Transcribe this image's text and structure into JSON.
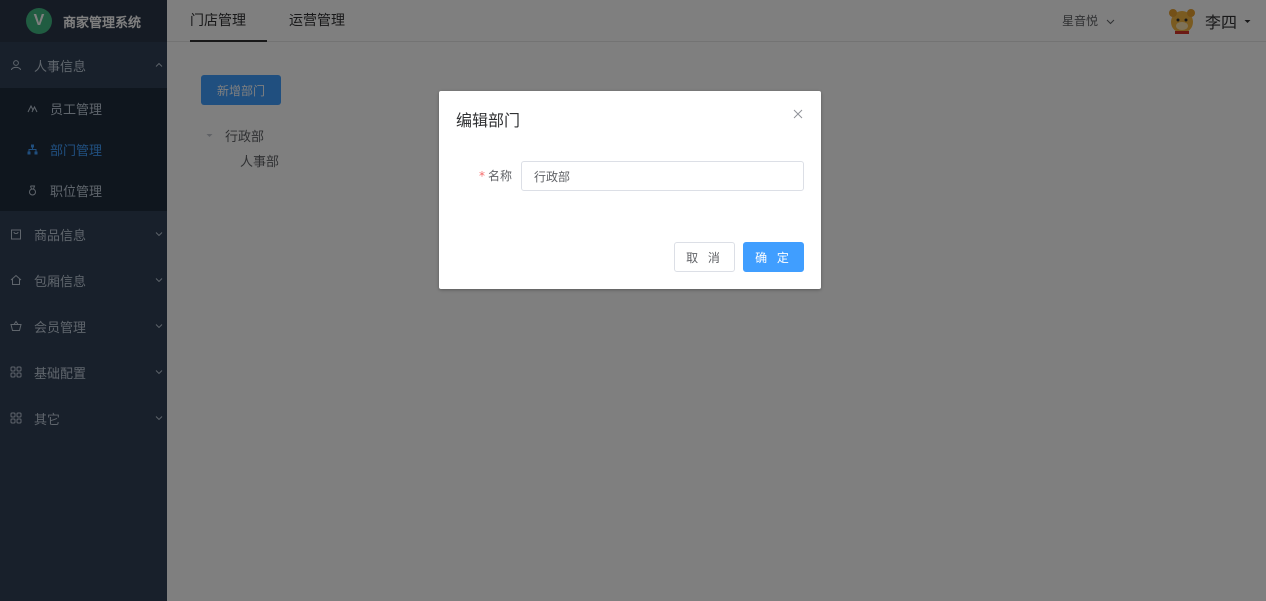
{
  "app": {
    "logo_letter": "V",
    "title": "商家管理系统"
  },
  "sidebar": {
    "groups": [
      {
        "label": "人事信息",
        "icon": "user-icon",
        "expanded": true,
        "children": [
          {
            "label": "员工管理",
            "icon": "people-icon",
            "active": false
          },
          {
            "label": "部门管理",
            "icon": "org-tree-icon",
            "active": true
          },
          {
            "label": "职位管理",
            "icon": "badge-icon",
            "active": false
          }
        ]
      },
      {
        "label": "商品信息",
        "icon": "bag-icon",
        "expanded": false
      },
      {
        "label": "包厢信息",
        "icon": "home-icon",
        "expanded": false
      },
      {
        "label": "会员管理",
        "icon": "basket-icon",
        "expanded": false
      },
      {
        "label": "基础配置",
        "icon": "grid-icon",
        "expanded": false
      },
      {
        "label": "其它",
        "icon": "grid-icon",
        "expanded": false
      }
    ]
  },
  "header": {
    "tabs": [
      {
        "label": "门店管理",
        "active": true
      },
      {
        "label": "运营管理",
        "active": false
      }
    ],
    "store_select": "星音悦",
    "user_name": "李四"
  },
  "main": {
    "new_button": "新增部门",
    "tree": [
      {
        "label": "行政部",
        "expanded": true,
        "children": [
          {
            "label": "人事部"
          }
        ]
      }
    ]
  },
  "dialog": {
    "title": "编辑部门",
    "required_mark": "*",
    "field_label": "名称",
    "field_value": "行政部",
    "cancel_label": "取 消",
    "ok_label": "确 定"
  },
  "colors": {
    "sidebar_bg": "#304156",
    "submenu_bg": "#1f2d3d",
    "accent": "#409eff",
    "logo": "#41b883",
    "required": "#f56c6c",
    "mask": "rgba(0,0,0,0.5)"
  }
}
